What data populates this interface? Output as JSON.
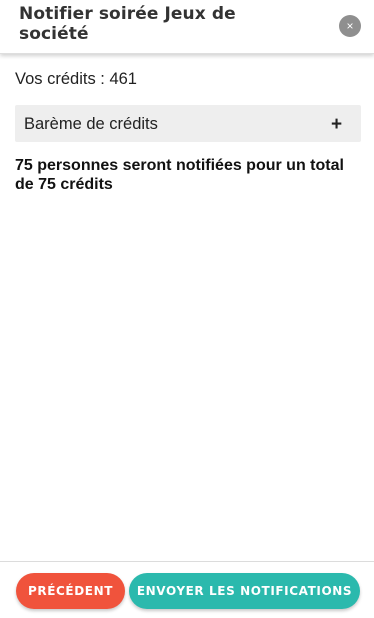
{
  "header": {
    "title": "Notifier soirée Jeux de société",
    "close_icon": "×"
  },
  "credits": {
    "text": "Vos crédits : 461"
  },
  "accordion": {
    "label": "Barème de crédits",
    "toggle_icon": "+"
  },
  "summary": {
    "text": "75 personnes seront notifiées pour un total de 75 crédits"
  },
  "footer": {
    "prev_label": "PRÉCÉDENT",
    "send_label": "ENVOYER LES NOTIFICATIONS"
  },
  "colors": {
    "prev_button": "#f0533c",
    "send_button": "#2bb9ad",
    "close_button": "#8f8f8f",
    "accordion_bg": "#eeeeee"
  }
}
